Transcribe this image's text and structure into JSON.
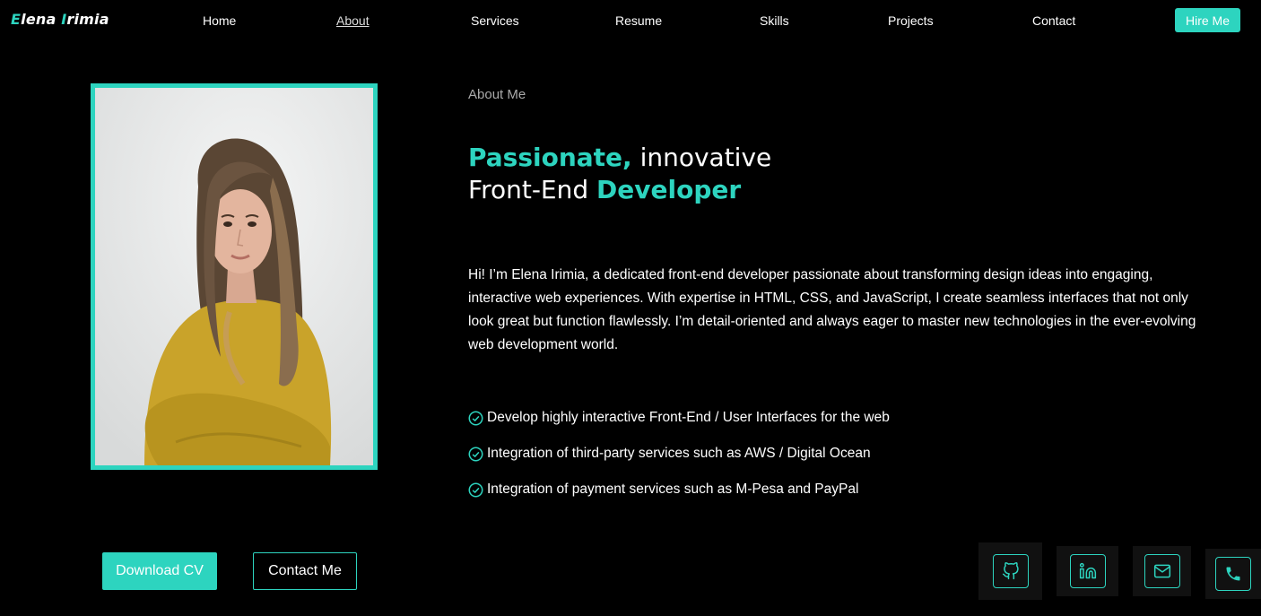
{
  "nav": {
    "logo_first": "Elena",
    "logo_last": "Irimia",
    "links": [
      "Home",
      "About",
      "Services",
      "Resume",
      "Skills",
      "Projects",
      "Contact"
    ],
    "active": "About",
    "hire_label": "Hire Me"
  },
  "about": {
    "label": "About Me",
    "headline_accent1": "Passionate,",
    "headline_plain1": " innovative",
    "headline_plain2": "Front-End ",
    "headline_accent2": "Developer",
    "intro": "Hi! I’m Elena Irimia, a dedicated front-end developer passionate about transforming design ideas into engaging, interactive web experiences. With expertise in HTML, CSS, and JavaScript, I create seamless interfaces that not only look great but function flawlessly. I’m detail-oriented and always eager to master new technologies in the ever-evolving web development world.",
    "features": [
      "Develop highly interactive Front-End / User Interfaces for the web",
      "Integration of third-party services such as AWS / Digital Ocean",
      "Integration of payment services such as M-Pesa and PayPal"
    ]
  },
  "buttons": {
    "download_cv": "Download CV",
    "contact_me": "Contact Me"
  },
  "social": [
    "github-icon",
    "linkedin-icon",
    "mail-icon",
    "phone-icon"
  ],
  "colors": {
    "accent": "#2dd4bf",
    "background": "#000000"
  }
}
